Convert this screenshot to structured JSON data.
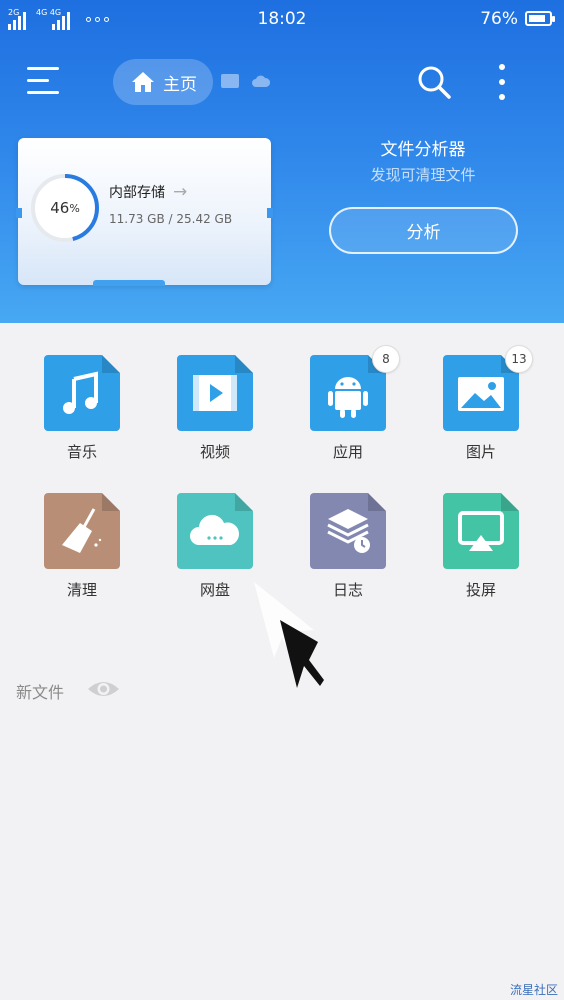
{
  "status_bar": {
    "sim1_label": "2G",
    "sim2_label": "4G 4G",
    "time": "18:02",
    "battery_percent": "76%",
    "battery_level": 0.76
  },
  "header": {
    "home_tab_label": "主页",
    "icons": [
      "menu-icon",
      "home-icon",
      "chat-icon",
      "cloud-icon",
      "search-icon",
      "more-vertical-icon"
    ]
  },
  "storage": {
    "title": "内部存储",
    "percent": "46",
    "percent_sign": "%",
    "usage": "11.73 GB / 25.42 GB",
    "used_fraction": 0.46
  },
  "analyzer": {
    "title": "文件分析器",
    "subtitle": "发现可清理文件",
    "button_label": "分析"
  },
  "categories": [
    {
      "label": "音乐",
      "icon": "music-icon",
      "color": "#2f9fe8"
    },
    {
      "label": "视频",
      "icon": "video-icon",
      "color": "#2f9fe8"
    },
    {
      "label": "应用",
      "icon": "android-icon",
      "color": "#2f9fe8",
      "badge": "8"
    },
    {
      "label": "图片",
      "icon": "image-icon",
      "color": "#2f9fe8",
      "badge": "13"
    },
    {
      "label": "清理",
      "icon": "broom-icon",
      "color": "#b88f76"
    },
    {
      "label": "网盘",
      "icon": "cloud-drive-icon",
      "color": "#4ec3c0"
    },
    {
      "label": "日志",
      "icon": "log-icon",
      "color": "#8288b0"
    },
    {
      "label": "投屏",
      "icon": "cast-icon",
      "color": "#43c4a4"
    }
  ],
  "recent": {
    "label": "新文件"
  },
  "watermark": "流星社区"
}
